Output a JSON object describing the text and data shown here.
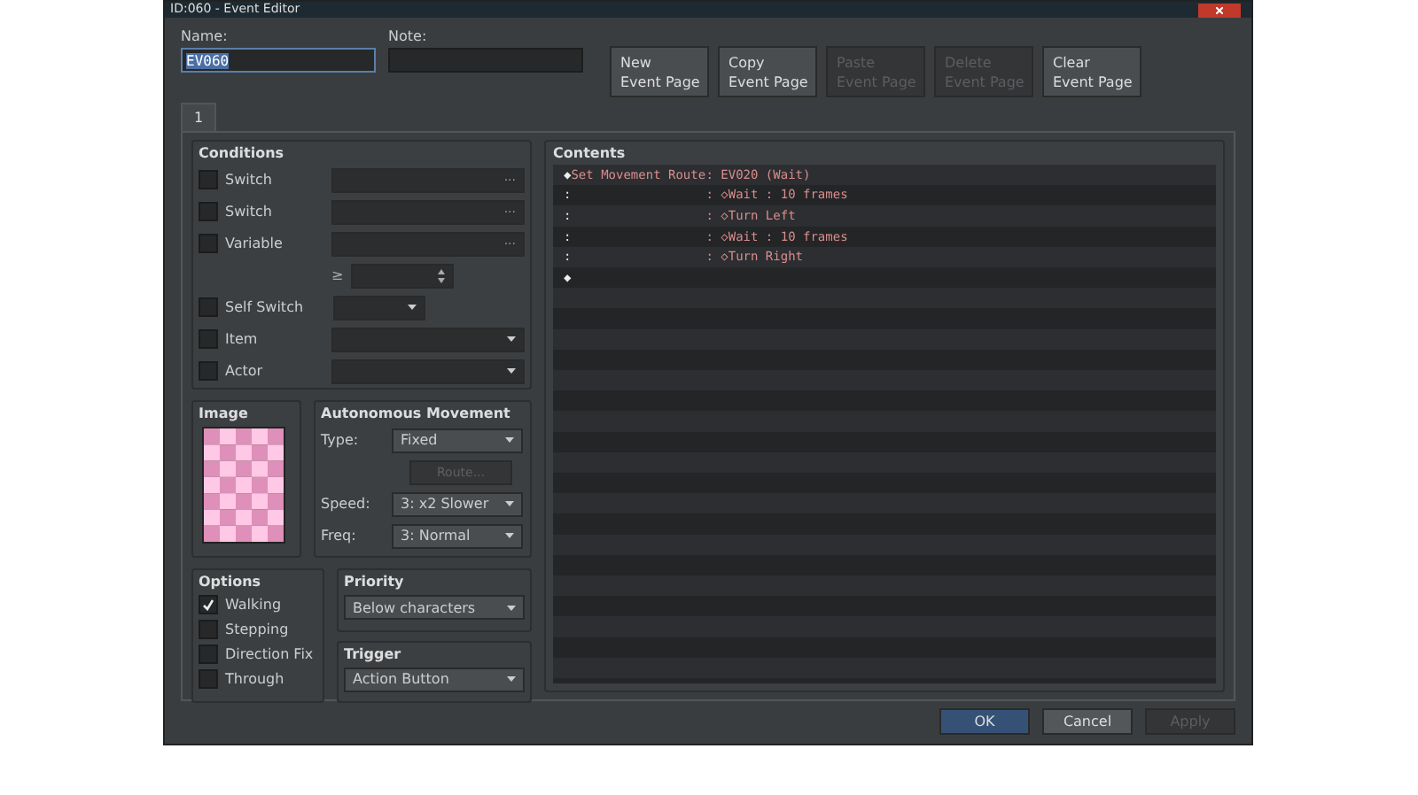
{
  "window": {
    "title": "ID:060 - Event Editor"
  },
  "name": {
    "label": "Name:",
    "value": "EV060",
    "selected": true
  },
  "note": {
    "label": "Note:"
  },
  "page_buttons": [
    {
      "label": "New\nEvent Page",
      "disabled": false
    },
    {
      "label": "Copy\nEvent Page",
      "disabled": false
    },
    {
      "label": "Paste\nEvent Page",
      "disabled": true
    },
    {
      "label": "Delete\nEvent Page",
      "disabled": true
    },
    {
      "label": "Clear\nEvent Page",
      "disabled": false
    }
  ],
  "tabs": [
    {
      "label": "1",
      "selected": true
    }
  ],
  "conditions": {
    "title": "Conditions",
    "rows": [
      {
        "kind": "picker",
        "label": "Switch",
        "checked": false,
        "button": "···"
      },
      {
        "kind": "picker",
        "label": "Switch",
        "checked": false,
        "button": "···"
      },
      {
        "kind": "picker",
        "label": "Variable",
        "checked": false,
        "button": "···"
      },
      {
        "kind": "compare",
        "symbol": "≥"
      },
      {
        "kind": "short_select",
        "label": "Self Switch",
        "checked": false
      },
      {
        "kind": "select",
        "label": "Item",
        "checked": false
      },
      {
        "kind": "select",
        "label": "Actor",
        "checked": false
      }
    ]
  },
  "image": {
    "title": "Image"
  },
  "autonomous": {
    "title": "Autonomous Movement",
    "fields": [
      {
        "kind": "select",
        "label": "Type:",
        "value": "Fixed"
      },
      {
        "kind": "button",
        "label": "Route...",
        "disabled": true
      },
      {
        "kind": "select",
        "label": "Speed:",
        "value": "3: x2 Slower"
      },
      {
        "kind": "select",
        "label": "Freq:",
        "value": "3: Normal"
      }
    ]
  },
  "options": {
    "title": "Options",
    "items": [
      {
        "label": "Walking",
        "checked": true
      },
      {
        "label": "Stepping",
        "checked": false
      },
      {
        "label": "Direction Fix",
        "checked": false
      },
      {
        "label": "Through",
        "checked": false
      }
    ]
  },
  "priority": {
    "title": "Priority",
    "value": "Below characters"
  },
  "trigger": {
    "title": "Trigger",
    "value": "Action Button"
  },
  "contents": {
    "title": "Contents",
    "lines": [
      {
        "marker": "◆",
        "command": "Set Movement Route",
        "detail": ": EV020 (Wait)"
      },
      {
        "marker": ":",
        "detail": ": ◇Wait : 10 frames"
      },
      {
        "marker": ":",
        "detail": ": ◇Turn Left"
      },
      {
        "marker": ":",
        "detail": ": ◇Wait : 10 frames"
      },
      {
        "marker": ":",
        "detail": ": ◇Turn Right"
      },
      {
        "marker": "◆"
      }
    ]
  },
  "footer_buttons": [
    {
      "label": "OK",
      "kind": "primary",
      "disabled": false
    },
    {
      "label": "Cancel",
      "kind": "normal",
      "disabled": false
    },
    {
      "label": "Apply",
      "kind": "normal",
      "disabled": true
    }
  ]
}
